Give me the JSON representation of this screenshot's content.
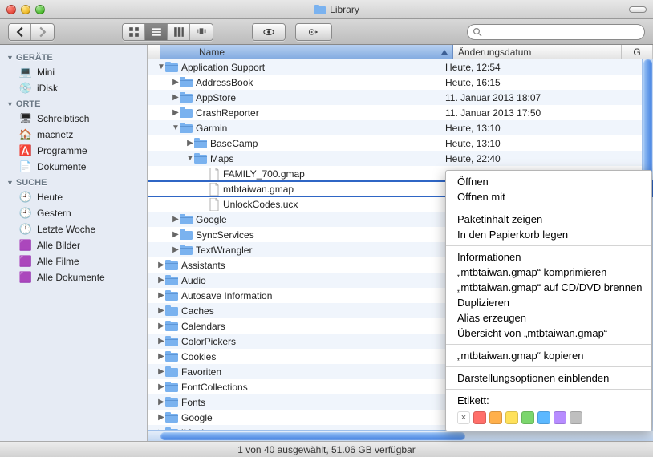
{
  "window": {
    "title": "Library"
  },
  "columns": {
    "name": "Name",
    "date": "Änderungsdatum",
    "g": "G"
  },
  "search": {
    "placeholder": ""
  },
  "sidebar": {
    "sections": [
      {
        "header": "GERÄTE",
        "items": [
          {
            "icon": "💻",
            "label": "Mini"
          },
          {
            "icon": "💿",
            "label": "iDisk"
          }
        ]
      },
      {
        "header": "ORTE",
        "items": [
          {
            "icon": "🖥",
            "label": "Schreibtisch"
          },
          {
            "icon": "🏠",
            "label": "macnetz"
          },
          {
            "icon": "🅰️",
            "label": "Programme"
          },
          {
            "icon": "📄",
            "label": "Dokumente"
          }
        ]
      },
      {
        "header": "SUCHE",
        "items": [
          {
            "icon": "🕘",
            "label": "Heute"
          },
          {
            "icon": "🕘",
            "label": "Gestern"
          },
          {
            "icon": "🕘",
            "label": "Letzte Woche"
          },
          {
            "icon": "🟪",
            "label": "Alle Bilder"
          },
          {
            "icon": "🟪",
            "label": "Alle Filme"
          },
          {
            "icon": "🟪",
            "label": "Alle Dokumente"
          }
        ]
      }
    ]
  },
  "rows": [
    {
      "indent": 0,
      "exp": "down",
      "type": "folder",
      "name": "Application Support",
      "date": "Heute, 12:54"
    },
    {
      "indent": 1,
      "exp": "right",
      "type": "folder",
      "name": "AddressBook",
      "date": "Heute, 16:15"
    },
    {
      "indent": 1,
      "exp": "right",
      "type": "folder",
      "name": "AppStore",
      "date": "11. Januar 2013 18:07"
    },
    {
      "indent": 1,
      "exp": "right",
      "type": "folder",
      "name": "CrashReporter",
      "date": "11. Januar 2013 17:50"
    },
    {
      "indent": 1,
      "exp": "down",
      "type": "folder",
      "name": "Garmin",
      "date": "Heute, 13:10"
    },
    {
      "indent": 2,
      "exp": "right",
      "type": "folder",
      "name": "BaseCamp",
      "date": "Heute, 13:10"
    },
    {
      "indent": 2,
      "exp": "down",
      "type": "folder",
      "name": "Maps",
      "date": "Heute, 22:40"
    },
    {
      "indent": 3,
      "exp": "",
      "type": "doc",
      "name": "FAMILY_700.gmap",
      "date": ""
    },
    {
      "indent": 3,
      "exp": "",
      "type": "doc",
      "name": "mtbtaiwan.gmap",
      "date": "",
      "selected": true
    },
    {
      "indent": 3,
      "exp": "",
      "type": "doc",
      "name": "UnlockCodes.ucx",
      "date": ""
    },
    {
      "indent": 1,
      "exp": "right",
      "type": "folder",
      "name": "Google",
      "date": ""
    },
    {
      "indent": 1,
      "exp": "right",
      "type": "folder",
      "name": "SyncServices",
      "date": ""
    },
    {
      "indent": 1,
      "exp": "right",
      "type": "folder",
      "name": "TextWrangler",
      "date": ""
    },
    {
      "indent": 0,
      "exp": "right",
      "type": "folder",
      "name": "Assistants",
      "date": ""
    },
    {
      "indent": 0,
      "exp": "right",
      "type": "folder",
      "name": "Audio",
      "date": ""
    },
    {
      "indent": 0,
      "exp": "right",
      "type": "folder",
      "name": "Autosave Information",
      "date": ""
    },
    {
      "indent": 0,
      "exp": "right",
      "type": "folder",
      "name": "Caches",
      "date": ""
    },
    {
      "indent": 0,
      "exp": "right",
      "type": "folder",
      "name": "Calendars",
      "date": ""
    },
    {
      "indent": 0,
      "exp": "right",
      "type": "folder",
      "name": "ColorPickers",
      "date": ""
    },
    {
      "indent": 0,
      "exp": "right",
      "type": "folder",
      "name": "Cookies",
      "date": ""
    },
    {
      "indent": 0,
      "exp": "right",
      "type": "folder",
      "name": "Favoriten",
      "date": ""
    },
    {
      "indent": 0,
      "exp": "right",
      "type": "folder",
      "name": "FontCollections",
      "date": ""
    },
    {
      "indent": 0,
      "exp": "right",
      "type": "folder",
      "name": "Fonts",
      "date": ""
    },
    {
      "indent": 0,
      "exp": "right",
      "type": "folder",
      "name": "Google",
      "date": ""
    },
    {
      "indent": 0,
      "exp": "right",
      "type": "folder",
      "name": "iMovie",
      "date": ""
    }
  ],
  "context_menu": {
    "open": "Öffnen",
    "openwith": "Öffnen mit",
    "pkg": "Paketinhalt zeigen",
    "trash": "In den Papierkorb legen",
    "info": "Informationen",
    "compress": "„mtbtaiwan.gmap“ komprimieren",
    "burn": "„mtbtaiwan.gmap“ auf CD/DVD brennen",
    "dup": "Duplizieren",
    "alias": "Alias erzeugen",
    "ql": "Übersicht von „mtbtaiwan.gmap“",
    "copy": "„mtbtaiwan.gmap“ kopieren",
    "viewopts": "Darstellungsoptionen einblenden",
    "labeltitle": "Etikett:",
    "colors": [
      "#ff6f6a",
      "#ffb04c",
      "#ffe15a",
      "#7bd66d",
      "#5cb8ff",
      "#b78cff",
      "#bfbfbf"
    ]
  },
  "status": "1 von 40 ausgewählt, 51.06 GB verfügbar"
}
